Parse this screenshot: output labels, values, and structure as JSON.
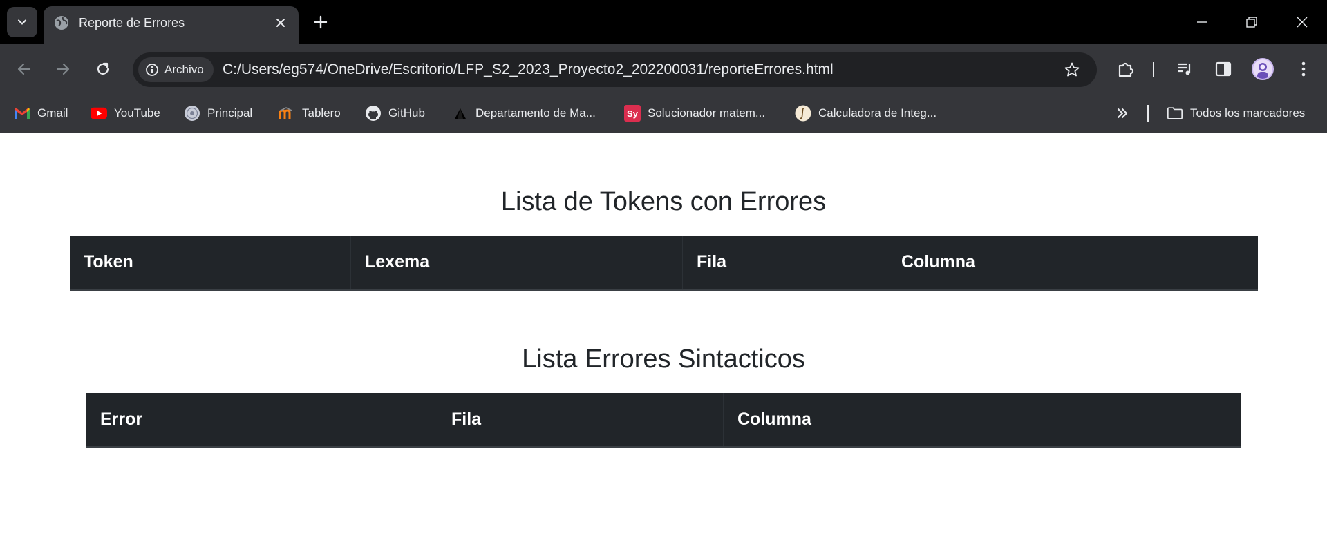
{
  "tab": {
    "title": "Reporte de Errores"
  },
  "toolbar": {
    "site_chip": "Archivo",
    "url": "C:/Users/eg574/OneDrive/Escritorio/LFP_S2_2023_Proyecto2_202200031/reporteErrores.html"
  },
  "bookmarks": [
    {
      "label": "Gmail",
      "icon": "gmail-icon"
    },
    {
      "label": "YouTube",
      "icon": "youtube-icon"
    },
    {
      "label": "Principal",
      "icon": "seal-icon"
    },
    {
      "label": "Tablero",
      "icon": "moodle-icon"
    },
    {
      "label": "GitHub",
      "icon": "github-icon"
    },
    {
      "label": "Departamento de Ma...",
      "icon": "triangle-icon"
    },
    {
      "label": "Solucionador matem...",
      "icon": "symbolab-icon"
    },
    {
      "label": "Calculadora de Integ...",
      "icon": "integral-icon"
    }
  ],
  "all_bookmarks": "Todos los marcadores",
  "page": {
    "tokens_title": "Lista de Tokens con Errores",
    "tokens_headers": [
      "Token",
      "Lexema",
      "Fila",
      "Columna"
    ],
    "syntax_title": "Lista Errores Sintacticos",
    "syntax_headers": [
      "Error",
      "Fila",
      "Columna"
    ]
  },
  "colors": {
    "table_header_bg": "#212529",
    "title_text": "#212529",
    "chrome_dark": "#35363a"
  }
}
